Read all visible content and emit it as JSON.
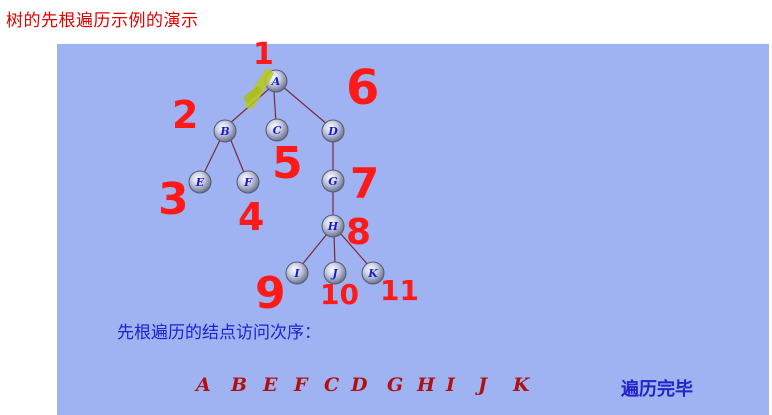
{
  "title": "树的先根遍历示例的演示",
  "nodes": {
    "A": "A",
    "B": "B",
    "C": "C",
    "D": "D",
    "E": "E",
    "F": "F",
    "G": "G",
    "H": "H",
    "I": "I",
    "J": "J",
    "K": "K"
  },
  "annotations": [
    "1",
    "2",
    "3",
    "4",
    "5",
    "6",
    "7",
    "8",
    "9",
    "10",
    "11"
  ],
  "caption": "先根遍历的结点访问次序：",
  "sequence": [
    "A",
    "B",
    "E",
    "F",
    "C",
    "D",
    "G",
    "H",
    "I",
    "J",
    "K"
  ],
  "status": "遍历完毕",
  "colors": {
    "panel": "#9fb3f2",
    "title": "#e00000",
    "annotation": "#ff1a1a",
    "sequence": "#b01010",
    "caption": "#2020d0"
  }
}
